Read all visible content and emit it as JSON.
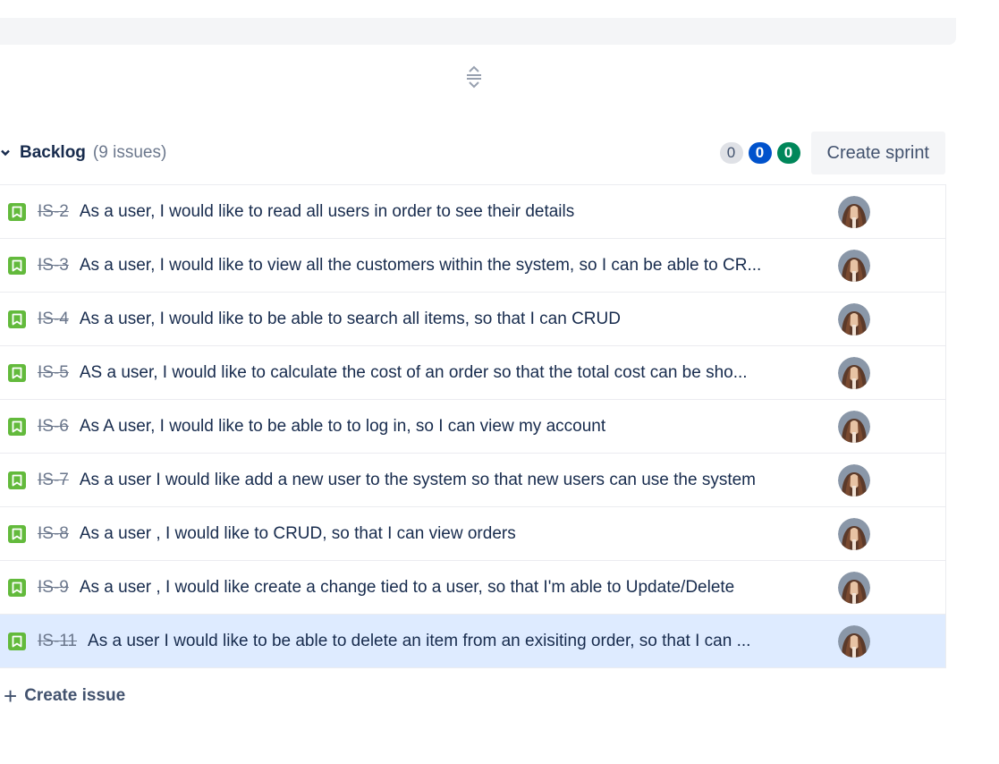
{
  "backlog": {
    "title": "Backlog",
    "issue_count": "(9 issues)",
    "status_counts": [
      "0",
      "0",
      "0"
    ],
    "create_sprint_label": "Create sprint"
  },
  "issues": [
    {
      "key": "IS-2",
      "summary": "As a user, I would like to read all users in order to see their details"
    },
    {
      "key": "IS-3",
      "summary": "As a user, I would like to view all the customers within the system, so I can be able to CR..."
    },
    {
      "key": "IS-4",
      "summary": "As a user, I would like to be able to search all items, so that I can CRUD"
    },
    {
      "key": "IS-5",
      "summary": "AS a user, I would like to calculate the cost of an order so that the total cost can be sho..."
    },
    {
      "key": "IS-6",
      "summary": "As A user, I would like to be able to to log in, so I can view my account"
    },
    {
      "key": "IS-7",
      "summary": "As a user I would like add a new user to the system so that new users can use the system"
    },
    {
      "key": "IS-8",
      "summary": "As a user , I would like to CRUD, so that I can view orders"
    },
    {
      "key": "IS-9",
      "summary": "As a user , I would like create a change tied to a user, so that I'm able to Update/Delete"
    },
    {
      "key": "IS-11",
      "summary": "As a user I would like to be able to delete an item from an exisiting order, so that I can ..."
    }
  ],
  "create_issue_label": "Create issue",
  "colors": {
    "story": "#63ba3c",
    "selected_row": "#deebff",
    "todo_pill": "#dfe1e6",
    "in_progress_pill": "#0052cc",
    "done_pill": "#00875a"
  },
  "icons": {
    "collapse": "chevron-down-icon",
    "story": "bookmark-icon",
    "resize": "drag-handle-icon",
    "add": "plus-icon"
  }
}
